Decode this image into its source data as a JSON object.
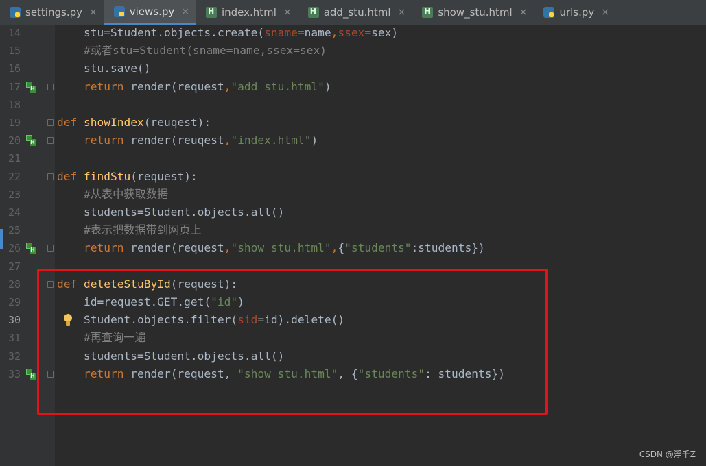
{
  "tabs": [
    {
      "label": "settings.py",
      "icon": "python-file-icon",
      "active": false
    },
    {
      "label": "views.py",
      "icon": "python-file-icon",
      "active": true
    },
    {
      "label": "index.html",
      "icon": "html-file-icon",
      "active": false
    },
    {
      "label": "add_stu.html",
      "icon": "html-file-icon",
      "active": false
    },
    {
      "label": "show_stu.html",
      "icon": "html-file-icon",
      "active": false
    },
    {
      "label": "urls.py",
      "icon": "python-file-icon",
      "active": false
    }
  ],
  "close_glyph": "×",
  "current_line": "30",
  "lines": [
    {
      "num": "14",
      "segments": [
        {
          "t": "    stu",
          "c": ""
        },
        {
          "t": "=",
          "c": ""
        },
        {
          "t": "Student.objects.create(",
          "c": ""
        },
        {
          "t": "sname",
          "c": "prm"
        },
        {
          "t": "=name",
          "c": ""
        },
        {
          "t": ",",
          "c": "kw"
        },
        {
          "t": "ssex",
          "c": "prm"
        },
        {
          "t": "=sex)",
          "c": ""
        }
      ]
    },
    {
      "num": "15",
      "segments": [
        {
          "t": "    #或者stu=Student(sname=name,ssex=sex)",
          "c": "cmt"
        }
      ]
    },
    {
      "num": "16",
      "segments": [
        {
          "t": "    stu.save()",
          "c": ""
        }
      ]
    },
    {
      "num": "17",
      "marker": true,
      "fold": true,
      "segments": [
        {
          "t": "    ",
          "c": ""
        },
        {
          "t": "return",
          "c": "kw"
        },
        {
          "t": " render(request",
          "c": ""
        },
        {
          "t": ",",
          "c": "kw"
        },
        {
          "t": "\"add_stu.html\"",
          "c": "str"
        },
        {
          "t": ")",
          "c": ""
        }
      ]
    },
    {
      "num": "18",
      "segments": []
    },
    {
      "num": "19",
      "fold": true,
      "segments": [
        {
          "t": "def",
          "c": "kw"
        },
        {
          "t": " ",
          "c": ""
        },
        {
          "t": "showIndex",
          "c": "fn"
        },
        {
          "t": "(reuqest):",
          "c": ""
        }
      ]
    },
    {
      "num": "20",
      "marker": true,
      "fold": true,
      "segments": [
        {
          "t": "    ",
          "c": ""
        },
        {
          "t": "return",
          "c": "kw"
        },
        {
          "t": " render(reuqest",
          "c": ""
        },
        {
          "t": ",",
          "c": "kw"
        },
        {
          "t": "\"index.html\"",
          "c": "str"
        },
        {
          "t": ")",
          "c": ""
        }
      ]
    },
    {
      "num": "21",
      "segments": []
    },
    {
      "num": "22",
      "fold": true,
      "segments": [
        {
          "t": "def",
          "c": "kw"
        },
        {
          "t": " ",
          "c": ""
        },
        {
          "t": "findStu",
          "c": "fn"
        },
        {
          "t": "(request):",
          "c": ""
        }
      ]
    },
    {
      "num": "23",
      "segments": [
        {
          "t": "    #从表中获取数据",
          "c": "cmt"
        }
      ]
    },
    {
      "num": "24",
      "segments": [
        {
          "t": "    students=Student.objects.all()",
          "c": ""
        }
      ]
    },
    {
      "num": "25",
      "segments": [
        {
          "t": "    #表示把数据带到网页上",
          "c": "cmt"
        }
      ]
    },
    {
      "num": "26",
      "marker": true,
      "fold": true,
      "segments": [
        {
          "t": "    ",
          "c": ""
        },
        {
          "t": "return",
          "c": "kw"
        },
        {
          "t": " render(request",
          "c": ""
        },
        {
          "t": ",",
          "c": "kw"
        },
        {
          "t": "\"show_stu.html\"",
          "c": "str"
        },
        {
          "t": ",",
          "c": "kw"
        },
        {
          "t": "{",
          "c": ""
        },
        {
          "t": "\"students\"",
          "c": "str"
        },
        {
          "t": ":students})",
          "c": ""
        }
      ]
    },
    {
      "num": "27",
      "segments": []
    },
    {
      "num": "28",
      "fold": true,
      "segments": [
        {
          "t": "def",
          "c": "kw"
        },
        {
          "t": " ",
          "c": ""
        },
        {
          "t": "deleteStuById",
          "c": "fn"
        },
        {
          "t": "(request):",
          "c": ""
        }
      ]
    },
    {
      "num": "29",
      "segments": [
        {
          "t": "    id=request.GET.get(",
          "c": ""
        },
        {
          "t": "\"id\"",
          "c": "str"
        },
        {
          "t": ")",
          "c": ""
        }
      ]
    },
    {
      "num": "30",
      "bulb": true,
      "segments": [
        {
          "t": "    Student.objects.filter(",
          "c": ""
        },
        {
          "t": "sid",
          "c": "prm"
        },
        {
          "t": "=id).delete()",
          "c": ""
        }
      ]
    },
    {
      "num": "31",
      "segments": [
        {
          "t": "    #再查询一遍",
          "c": "cmt"
        }
      ]
    },
    {
      "num": "32",
      "segments": [
        {
          "t": "    students=Student.objects.all()",
          "c": ""
        }
      ]
    },
    {
      "num": "33",
      "marker": true,
      "fold": true,
      "segments": [
        {
          "t": "    ",
          "c": ""
        },
        {
          "t": "return",
          "c": "kw"
        },
        {
          "t": " render(request, ",
          "c": ""
        },
        {
          "t": "\"show_stu.html\"",
          "c": "str"
        },
        {
          "t": ", {",
          "c": ""
        },
        {
          "t": "\"students\"",
          "c": "str"
        },
        {
          "t": ": students})",
          "c": ""
        }
      ]
    }
  ],
  "watermark": "CSDN @浮千Z",
  "colors": {
    "keyword": "#cc7832",
    "function": "#ffc66d",
    "string": "#6a8759",
    "comment": "#808080",
    "param": "#aa4926",
    "highlight_box": "#e0141b"
  }
}
